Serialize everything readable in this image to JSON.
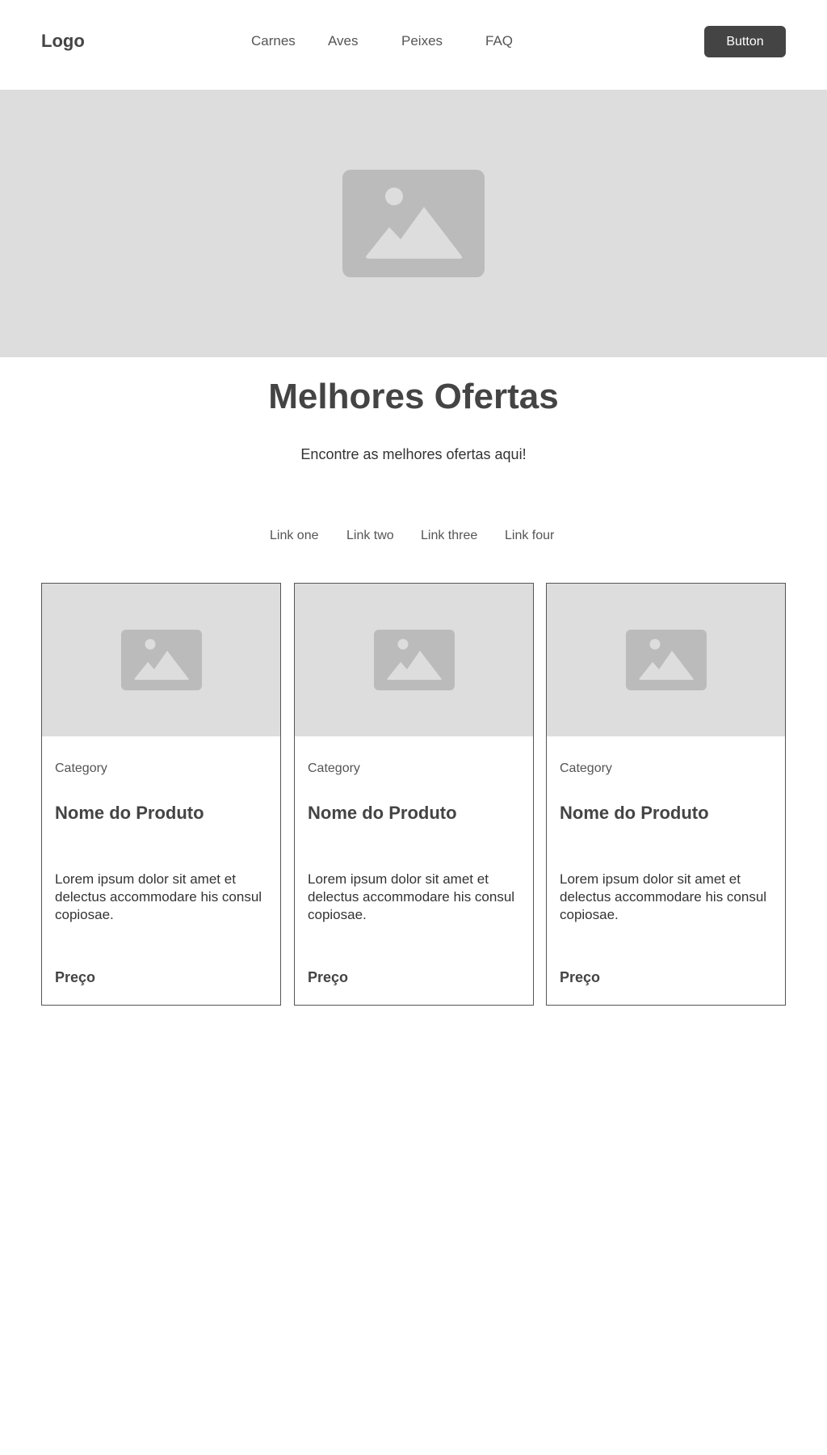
{
  "header": {
    "logo": "Logo",
    "nav": [
      "Carnes",
      "Aves",
      "Peixes",
      "FAQ"
    ],
    "button_label": "Button"
  },
  "hero": {
    "image_icon": "image-placeholder-icon"
  },
  "headline": {
    "title": "Melhores Ofertas",
    "subtitle": "Encontre as melhores ofertas aqui!"
  },
  "tabs": [
    "Link one",
    "Link two",
    "Link three",
    "Link four"
  ],
  "cards": [
    {
      "category": "Category",
      "title": "Nome do Produto",
      "description": "Lorem ipsum dolor sit amet et delectus accommodare his consul copiosae.",
      "price": "Preço"
    },
    {
      "category": "Category",
      "title": "Nome do Produto",
      "description": "Lorem ipsum dolor sit amet et delectus accommodare his consul copiosae.",
      "price": "Preço"
    },
    {
      "category": "Category",
      "title": "Nome do Produto",
      "description": "Lorem ipsum dolor sit amet et delectus accommodare his consul copiosae.",
      "price": "Preço"
    }
  ],
  "colors": {
    "dark": "#444444",
    "placeholder_bg": "#dddddd",
    "placeholder_icon": "#bbbbbb",
    "border": "#555555"
  }
}
